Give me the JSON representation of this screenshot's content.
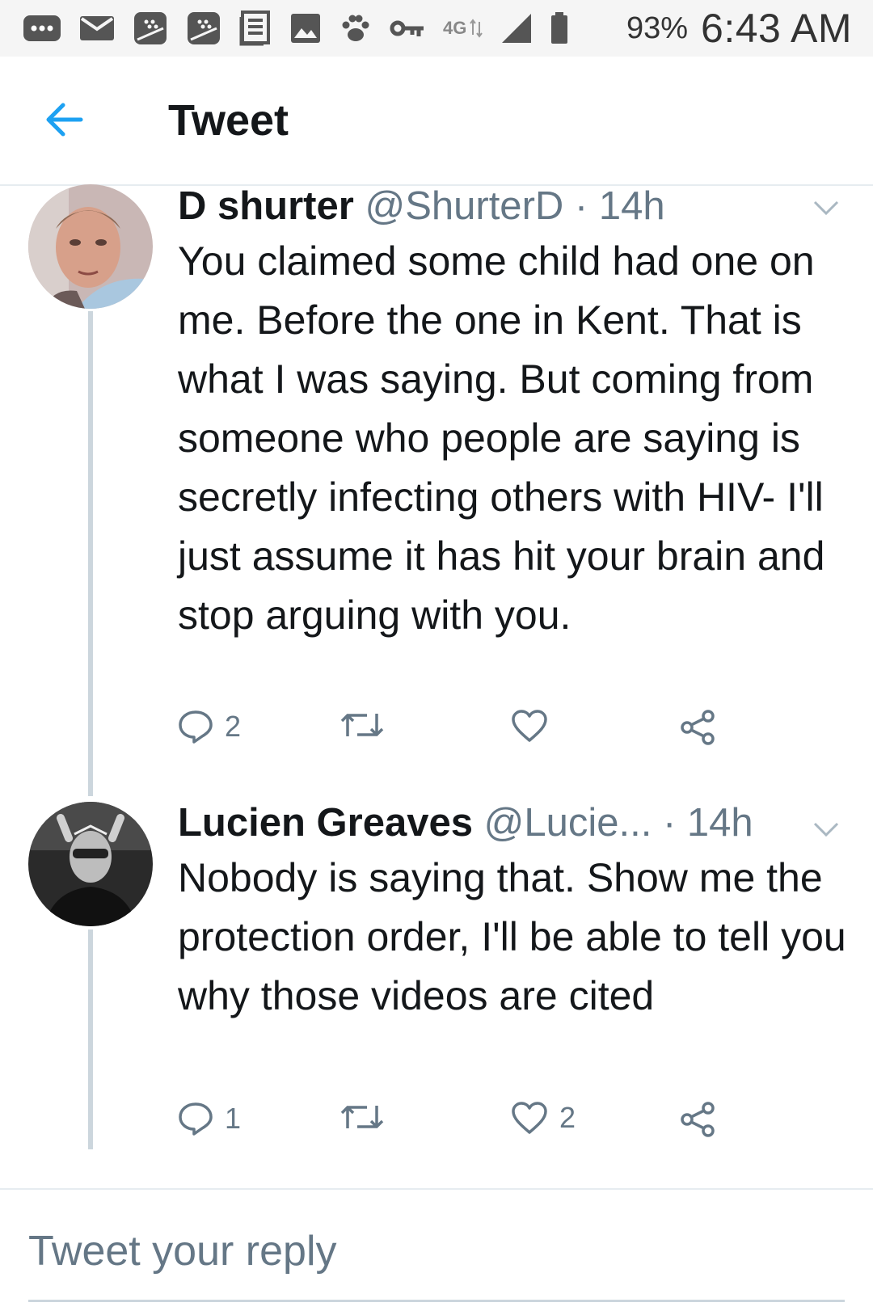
{
  "status_bar": {
    "icons": [
      "more-icon",
      "mail-icon",
      "blackberry-icon",
      "blackberry-icon",
      "news-icon",
      "image-icon",
      "paw-icon",
      "vpn-key-icon",
      "4g-lte-icon",
      "signal-icon",
      "battery-icon"
    ],
    "network": "4G",
    "battery": "93%",
    "time": "6:43 AM"
  },
  "header": {
    "title": "Tweet",
    "back_icon": "back-arrow-icon",
    "accent": "#1da1f2"
  },
  "tweets": [
    {
      "name": "D shurter",
      "handle": "@ShurterD",
      "separator": "·",
      "time": "14h",
      "text": "You claimed some child had one on me. Before the one in Kent. That is what I was saying. But coming from someone who people are saying is secretly infecting others with HIV- I'll just assume it has hit your brain and stop arguing with you.",
      "replies": "2",
      "retweets": "",
      "likes": ""
    },
    {
      "name": "Lucien Greaves",
      "handle": "@Lucie...",
      "separator": "·",
      "time": "14h",
      "text": "Nobody is saying that. Show me the protection order, I'll be able to tell you why those videos are cited",
      "replies": "1",
      "retweets": "",
      "likes": "2"
    }
  ],
  "composer": {
    "placeholder": "Tweet your reply"
  },
  "colors": {
    "text": "#14171a",
    "secondary": "#657786",
    "divider": "#e6ecf0",
    "thread": "#ccd6dd"
  }
}
